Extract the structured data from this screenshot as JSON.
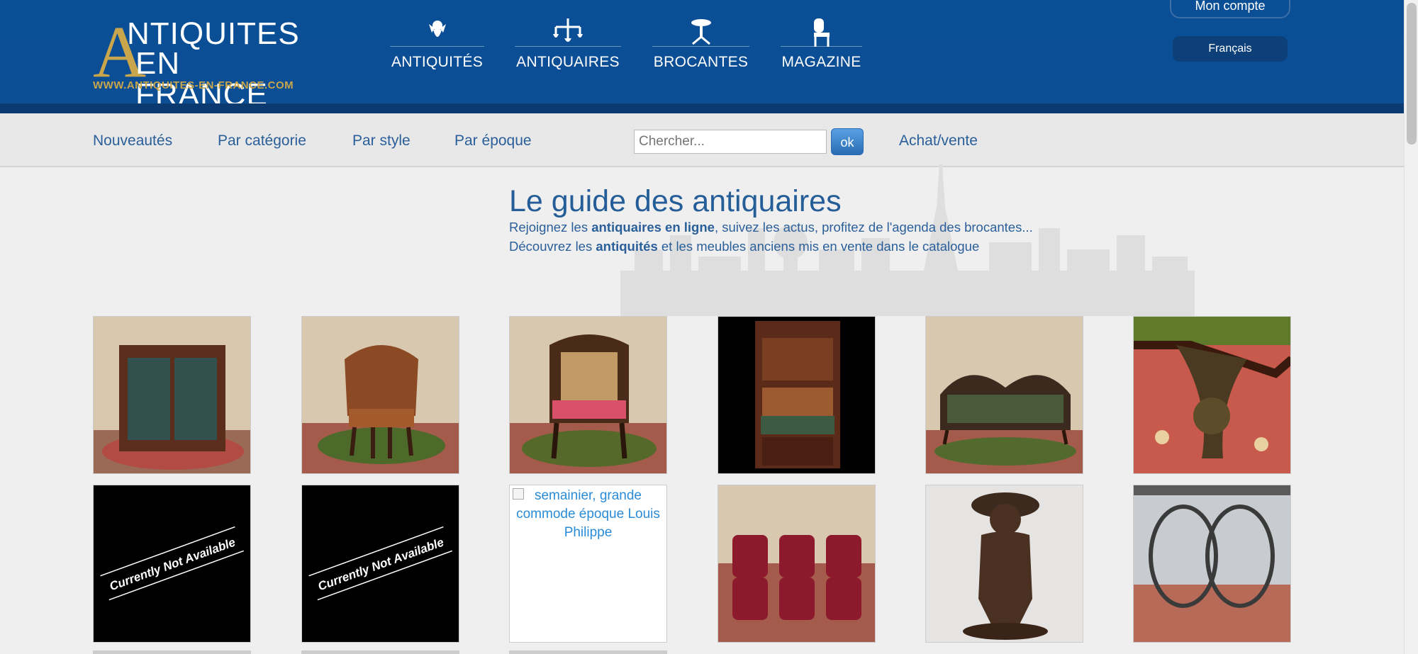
{
  "logo": {
    "big_letter": "A",
    "line1": "NTIQUITES",
    "line2": "EN FRANCE",
    "url": "WWW.ANTIQUITES-EN-FRANCE.COM"
  },
  "main_nav": [
    {
      "label": "ANTIQUITÉS",
      "icon": "cherub-icon"
    },
    {
      "label": "ANTIQUAIRES",
      "icon": "chandelier-icon"
    },
    {
      "label": "BROCANTES",
      "icon": "pedestal-table-icon"
    },
    {
      "label": "MAGAZINE",
      "icon": "chair-icon"
    }
  ],
  "account": {
    "label": "Mon compte",
    "language": "Français"
  },
  "sub_nav": {
    "new": "Nouveautés",
    "by_category": "Par catégorie",
    "by_style": "Par style",
    "by_period": "Par époque",
    "buy_sell": "Achat/vente"
  },
  "search": {
    "placeholder": "Chercher...",
    "button": "ok"
  },
  "guide": {
    "title": "Le guide des antiquaires",
    "line1_a": "Rejoignez les ",
    "line1_b": "antiquaires en ligne",
    "line1_c": ", suivez les actus, profitez de l'agenda des brocantes...",
    "line2_a": "Découvrez les ",
    "line2_b": "antiquités",
    "line2_c": " et les meubles anciens mis en vente dans le catalogue"
  },
  "products": [
    {
      "kind": "photo",
      "subject": "glazed bookcase"
    },
    {
      "kind": "photo",
      "subject": "leather office armchair"
    },
    {
      "kind": "photo",
      "subject": "caned bergere armchair"
    },
    {
      "kind": "photo",
      "subject": "secretary desk"
    },
    {
      "kind": "photo",
      "subject": "upholstered sofa"
    },
    {
      "kind": "photo",
      "subject": "carved table leg"
    },
    {
      "kind": "unavailable",
      "text": "Currently Not Available"
    },
    {
      "kind": "unavailable",
      "text": "Currently Not Available"
    },
    {
      "kind": "broken",
      "alt": "semainier, grande commode époque Louis Philippe"
    },
    {
      "kind": "photo",
      "subject": "set of six red chairs"
    },
    {
      "kind": "photo",
      "subject": "bronze statue of a boy"
    },
    {
      "kind": "photo",
      "subject": "metal table base"
    }
  ],
  "colors": {
    "header": "#0a4f96",
    "gold": "#c9a54b",
    "link": "#2a5f9a"
  }
}
